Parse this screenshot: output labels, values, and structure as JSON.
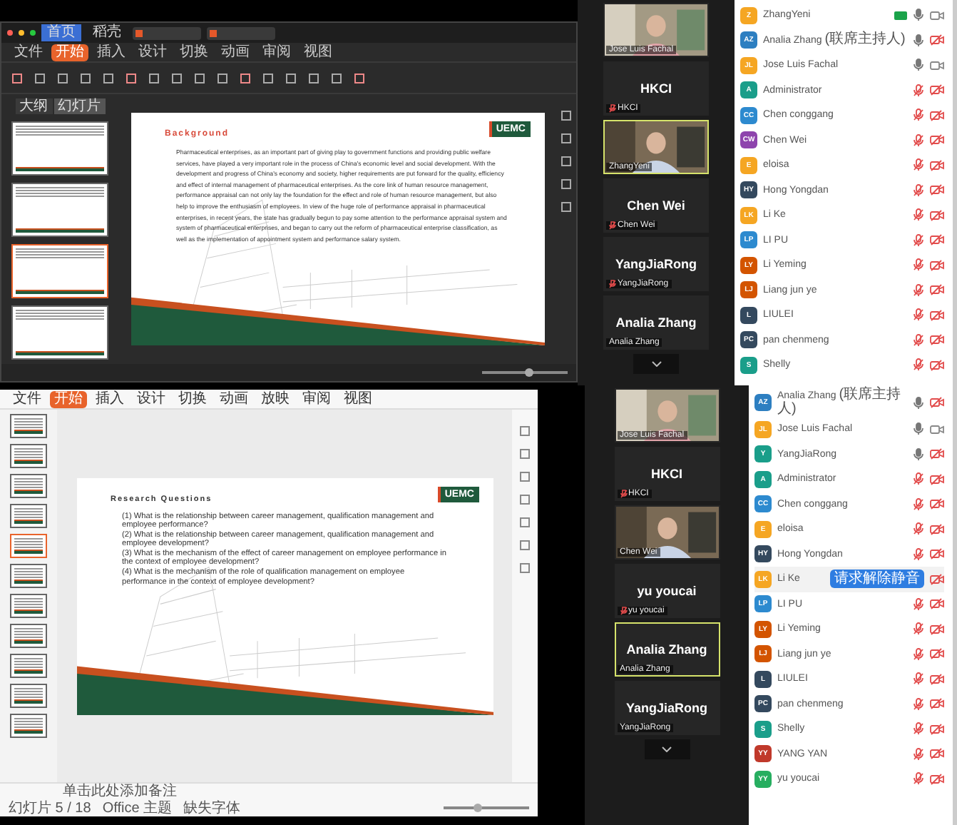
{
  "top": {
    "presentation": {
      "window_tabs": [
        {
          "label": "首页",
          "selected": true
        },
        {
          "label": "稻壳",
          "selected": false
        }
      ],
      "ribbon_tabs": [
        {
          "label": "文件",
          "selected": false
        },
        {
          "label": "开始",
          "selected": true
        },
        {
          "label": "插入",
          "selected": false
        },
        {
          "label": "设计",
          "selected": false
        },
        {
          "label": "切换",
          "selected": false
        },
        {
          "label": "动画",
          "selected": false
        },
        {
          "label": "审阅",
          "selected": false
        },
        {
          "label": "视图",
          "selected": false
        }
      ],
      "panel_tabs": [
        {
          "label": "大纲",
          "selected": false
        },
        {
          "label": "幻灯片",
          "selected": true
        }
      ],
      "thumbnails": [
        {
          "selected": false
        },
        {
          "selected": false
        },
        {
          "selected": true
        },
        {
          "selected": false
        }
      ],
      "slide": {
        "title": "Background",
        "logo": "UEMC",
        "body": "Pharmaceutical enterprises, as an important part of giving play to government functions and providing public welfare services, have played a very important role in the process of China's economic level and social development. With the development and progress of China's economy and society, higher requirements are put forward for the quality, efficiency and effect of internal management of pharmaceutical enterprises. As the core link of human resource management, performance appraisal can not only lay the foundation for the effect and role of human resource management, but also help to improve the enthusiasm of employees. In view of the huge role of performance appraisal in pharmaceutical enterprises, in recent years, the state has gradually begun to pay some attention to the performance appraisal system and system of pharmaceutical enterprises, and began to carry out the reform of pharmaceutical enterprise classification, as well as the implementation of appointment system and performance salary system."
      },
      "zoom": {
        "level": 0.55
      }
    },
    "video_tiles": [
      {
        "kind": "video",
        "name": "Jose Luis Fachal",
        "muted": false,
        "speaking": false
      },
      {
        "kind": "name",
        "display": "HKCI",
        "name": "HKCI",
        "muted": true,
        "speaking": false
      },
      {
        "kind": "video",
        "name": "ZhangYeni",
        "muted": false,
        "speaking": true
      },
      {
        "kind": "name",
        "display": "Chen Wei",
        "name": "Chen Wei",
        "muted": true,
        "speaking": false
      },
      {
        "kind": "name",
        "display": "YangJiaRong",
        "name": "YangJiaRong",
        "muted": true,
        "speaking": false
      },
      {
        "kind": "name",
        "display": "Analia Zhang",
        "name": "Analia Zhang",
        "muted": false,
        "speaking": false
      }
    ],
    "participants": [
      {
        "initials": "Z",
        "name": "ZhangYeni",
        "color": "#f5a623",
        "sharing": true,
        "muted": false,
        "video_on": true
      },
      {
        "initials": "AZ",
        "name": "Analia Zhang (联席主持人)",
        "color": "#2d7fc1",
        "sharing": false,
        "muted": false,
        "video_on": false
      },
      {
        "initials": "JL",
        "name": "Jose Luis Fachal",
        "color": "#f5a623",
        "sharing": false,
        "muted": false,
        "video_on": true
      },
      {
        "initials": "A",
        "name": "Administrator",
        "color": "#1a9e8a",
        "sharing": false,
        "muted": true,
        "video_on": false
      },
      {
        "initials": "CC",
        "name": "Chen conggang",
        "color": "#2d8acf",
        "sharing": false,
        "muted": true,
        "video_on": false
      },
      {
        "initials": "CW",
        "name": "Chen Wei",
        "color": "#8e44ad",
        "sharing": false,
        "muted": true,
        "video_on": false
      },
      {
        "initials": "E",
        "name": "eloisa",
        "color": "#f5a623",
        "sharing": false,
        "muted": true,
        "video_on": false
      },
      {
        "initials": "HY",
        "name": "Hong Yongdan",
        "color": "#34495e",
        "sharing": false,
        "muted": true,
        "video_on": false
      },
      {
        "initials": "LK",
        "name": "Li Ke",
        "color": "#f5a623",
        "sharing": false,
        "muted": true,
        "video_on": false
      },
      {
        "initials": "LP",
        "name": "LI PU",
        "color": "#2d8acf",
        "sharing": false,
        "muted": true,
        "video_on": false
      },
      {
        "initials": "LY",
        "name": "Li Yeming",
        "color": "#d35400",
        "sharing": false,
        "muted": true,
        "video_on": false
      },
      {
        "initials": "LJ",
        "name": "Liang jun ye",
        "color": "#d35400",
        "sharing": false,
        "muted": true,
        "video_on": false
      },
      {
        "initials": "L",
        "name": "LIULEI",
        "color": "#34495e",
        "sharing": false,
        "muted": true,
        "video_on": false
      },
      {
        "initials": "PC",
        "name": "pan chenmeng",
        "color": "#34495e",
        "sharing": false,
        "muted": true,
        "video_on": false
      },
      {
        "initials": "S",
        "name": "Shelly",
        "color": "#1a9e8a",
        "sharing": false,
        "muted": true,
        "video_on": false
      }
    ]
  },
  "bottom": {
    "presentation": {
      "ribbon_tabs": [
        {
          "label": "文件",
          "selected": false
        },
        {
          "label": "开始",
          "selected": true
        },
        {
          "label": "插入",
          "selected": false
        },
        {
          "label": "设计",
          "selected": false
        },
        {
          "label": "切换",
          "selected": false
        },
        {
          "label": "动画",
          "selected": false
        },
        {
          "label": "放映",
          "selected": false
        },
        {
          "label": "审阅",
          "selected": false
        },
        {
          "label": "视图",
          "selected": false
        }
      ],
      "thumbnails": [
        {
          "selected": false
        },
        {
          "selected": false
        },
        {
          "selected": false
        },
        {
          "selected": false
        },
        {
          "selected": true
        },
        {
          "selected": false
        },
        {
          "selected": false
        },
        {
          "selected": false
        },
        {
          "selected": false
        },
        {
          "selected": false
        },
        {
          "selected": false
        }
      ],
      "slide": {
        "title": "Research Questions",
        "logo": "UEMC",
        "questions": [
          "(1) What is the relationship between career management, qualification management and employee performance?",
          "(2) What is the relationship between career management, qualification management and employee development?",
          "(3) What is the mechanism of the effect of career management on employee performance in the context of employee development?",
          "(4) What is the mechanism of the role of qualification management on employee performance in the context of employee development?"
        ]
      },
      "notes_placeholder": "单击此处添加备注",
      "status": [
        "幻灯片 5 / 18",
        "Office 主题",
        "缺失字体"
      ],
      "zoom": {
        "level": 0.4
      }
    },
    "video_tiles": [
      {
        "kind": "video",
        "name": "Jose Luis Fachal",
        "muted": false,
        "speaking": false
      },
      {
        "kind": "name",
        "display": "HKCI",
        "name": "HKCI",
        "muted": true,
        "speaking": false
      },
      {
        "kind": "video",
        "name": "Chen Wei",
        "muted": false,
        "speaking": false
      },
      {
        "kind": "name",
        "display": "yu youcai",
        "name": "yu youcai",
        "muted": true,
        "speaking": false
      },
      {
        "kind": "name",
        "display": "Analia Zhang",
        "name": "Analia Zhang",
        "muted": false,
        "speaking": true
      },
      {
        "kind": "name",
        "display": "YangJiaRong",
        "name": "YangJiaRong",
        "muted": false,
        "speaking": false
      }
    ],
    "participants": [
      {
        "initials": "AZ",
        "name": "Analia Zhang (联席主持人)",
        "color": "#2d7fc1",
        "muted": false,
        "video_on": false
      },
      {
        "initials": "JL",
        "name": "Jose Luis Fachal",
        "color": "#f5a623",
        "muted": false,
        "video_on": true
      },
      {
        "initials": "Y",
        "name": "YangJiaRong",
        "color": "#1a9e8a",
        "muted": false,
        "video_on": false
      },
      {
        "initials": "A",
        "name": "Administrator",
        "color": "#1a9e8a",
        "muted": true,
        "video_on": false
      },
      {
        "initials": "CC",
        "name": "Chen conggang",
        "color": "#2d8acf",
        "muted": true,
        "video_on": false
      },
      {
        "initials": "E",
        "name": "eloisa",
        "color": "#f5a623",
        "muted": true,
        "video_on": false
      },
      {
        "initials": "HY",
        "name": "Hong Yongdan",
        "color": "#34495e",
        "muted": true,
        "video_on": false
      },
      {
        "initials": "LK",
        "name": "Li Ke",
        "color": "#f5a623",
        "video_on": false,
        "request": "请求解除静音"
      },
      {
        "initials": "LP",
        "name": "LI PU",
        "color": "#2d8acf",
        "muted": true,
        "video_on": false
      },
      {
        "initials": "LY",
        "name": "Li Yeming",
        "color": "#d35400",
        "muted": true,
        "video_on": false
      },
      {
        "initials": "LJ",
        "name": "Liang jun ye",
        "color": "#d35400",
        "muted": true,
        "video_on": false
      },
      {
        "initials": "L",
        "name": "LIULEI",
        "color": "#34495e",
        "muted": true,
        "video_on": false
      },
      {
        "initials": "PC",
        "name": "pan chenmeng",
        "color": "#34495e",
        "muted": true,
        "video_on": false
      },
      {
        "initials": "S",
        "name": "Shelly",
        "color": "#1a9e8a",
        "muted": true,
        "video_on": false
      },
      {
        "initials": "YY",
        "name": "YANG YAN",
        "color": "#c0392b",
        "muted": true,
        "video_on": false
      },
      {
        "initials": "YY",
        "name": "yu youcai",
        "color": "#27ae60",
        "muted": true,
        "video_on": false
      }
    ]
  }
}
